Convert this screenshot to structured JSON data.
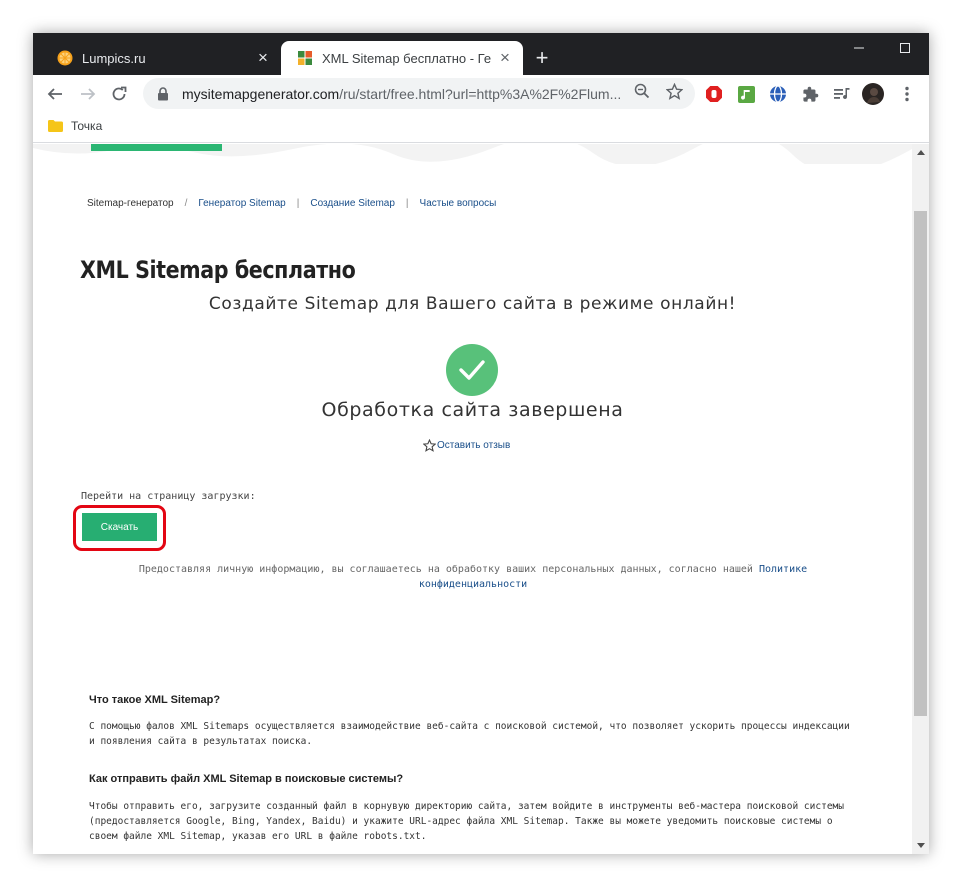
{
  "browser": {
    "tabs": [
      {
        "title": "Lumpics.ru",
        "active": false
      },
      {
        "title": "XML Sitemap бесплатно - Генер",
        "active": true
      }
    ],
    "address": {
      "host": "mysitemapgenerator.com",
      "path": "/ru/start/free.html?url=http%3A%2F%2Flum..."
    },
    "bookmarks": [
      {
        "label": "Точка"
      }
    ]
  },
  "breadcrumb": {
    "items": [
      {
        "label": "Sitemap-генератор",
        "is_link": false
      },
      {
        "label": "Генератор Sitemap",
        "is_link": true
      },
      {
        "label": "Создание Sitemap",
        "is_link": true
      },
      {
        "label": "Частые вопросы",
        "is_link": true
      }
    ],
    "separators": [
      "/",
      "|",
      "|"
    ]
  },
  "page": {
    "title": "XML Sitemap бесплатно",
    "subtitle": "Создайте Sitemap для Вашего сайта в режиме онлайн!",
    "status": "Обработка сайта завершена",
    "review_link": "Оставить отзыв",
    "goto_label": "Перейти на страницу загрузки:",
    "download_label": "Скачать",
    "privacy_text": "Предоставляя личную информацию, вы соглашаетесь на обработку ваших персональных данных, согласно нашей",
    "privacy_link": "Политике конфиденциальности"
  },
  "faq": [
    {
      "question": "Что такое XML Sitemap?",
      "answer": "С помощью фалов XML Sitemaps осуществляется взаимодействие веб-сайта с поисковой системой, что позволяет ускорить процессы индексации и появления сайта в результатах поиска."
    },
    {
      "question": "Как отправить файл XML Sitemap в поисковые системы?",
      "answer": "Чтобы отправить его, загрузите созданный файл в корнувую директорию сайта, затем войдите в инструменты веб-мастера поисковой системы (предоставляется Google, Bing, Yandex, Baidu) и укажите URL-адрес файла XML Sitemap. Также вы можете уведомить поисковые системы о своем файле XML Sitemap, указав его URL в файле robots.txt."
    }
  ],
  "colors": {
    "accent_green": "#27ae72",
    "check_green": "#58c17a",
    "highlight_red": "#e30613",
    "link_blue": "#1a4f8a",
    "tabstrip_dark": "#202124"
  },
  "icons": {
    "tab1": "orange-slice-icon",
    "tab2": "puzzle-favicon",
    "toolbar": [
      "back-arrow-icon",
      "forward-arrow-icon",
      "reload-icon",
      "lock-icon",
      "zoom-icon",
      "bookmark-star-icon"
    ],
    "extensions": [
      "adblock-icon",
      "music-extension-icon",
      "globe-extension-icon",
      "puzzle-extensions-icon",
      "media-queue-icon",
      "profile-avatar",
      "kebab-menu-icon"
    ]
  }
}
